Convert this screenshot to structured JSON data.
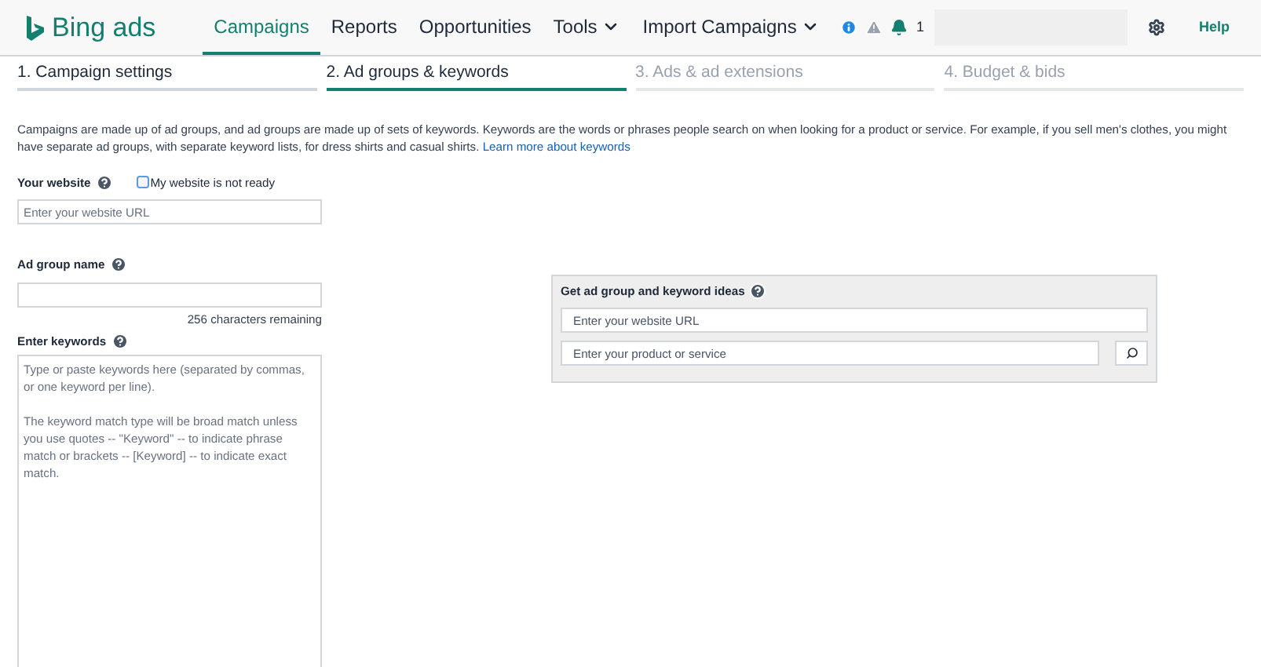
{
  "header": {
    "logo": "Bing ads",
    "nav": [
      {
        "label": "Campaigns",
        "selected": true,
        "dropdown": false
      },
      {
        "label": "Reports",
        "selected": false,
        "dropdown": false
      },
      {
        "label": "Opportunities",
        "selected": false,
        "dropdown": false
      },
      {
        "label": "Tools",
        "selected": false,
        "dropdown": true
      },
      {
        "label": "Import Campaigns",
        "selected": false,
        "dropdown": true
      }
    ],
    "notification_count": "1",
    "help": "Help"
  },
  "steps": [
    {
      "label": "1. Campaign settings",
      "selected": false,
      "disabled": false
    },
    {
      "label": "2. Ad groups & keywords",
      "selected": true,
      "disabled": false
    },
    {
      "label": "3. Ads & ad extensions",
      "selected": false,
      "disabled": true
    },
    {
      "label": "4. Budget & bids",
      "selected": false,
      "disabled": true
    }
  ],
  "intro": {
    "text": "Campaigns are made up of ad groups, and ad groups are made up of sets of keywords. Keywords are the words or phrases people search on when looking for a product or service. For example, if you sell men's clothes, you might have separate ad groups, with separate keyword lists, for dress shirts and casual shirts.",
    "link": "Learn more about keywords"
  },
  "website": {
    "label": "Your website",
    "checkbox_label": "My website is not ready",
    "checked": false,
    "placeholder": "Enter your website URL"
  },
  "ad_group": {
    "label": "Ad group name",
    "remaining": "256 characters remaining"
  },
  "keywords": {
    "label": "Enter keywords",
    "placeholder": "Type or paste keywords here (separated by commas, or one keyword per line).\n\nThe keyword match type will be broad match unless you use quotes -- \"Keyword\" -- to indicate phrase match or brackets -- [Keyword] -- to indicate exact match."
  },
  "ideas": {
    "title": "Get ad group and keyword ideas",
    "url_placeholder": "Enter your website URL",
    "product_placeholder": "Enter your product or service"
  }
}
